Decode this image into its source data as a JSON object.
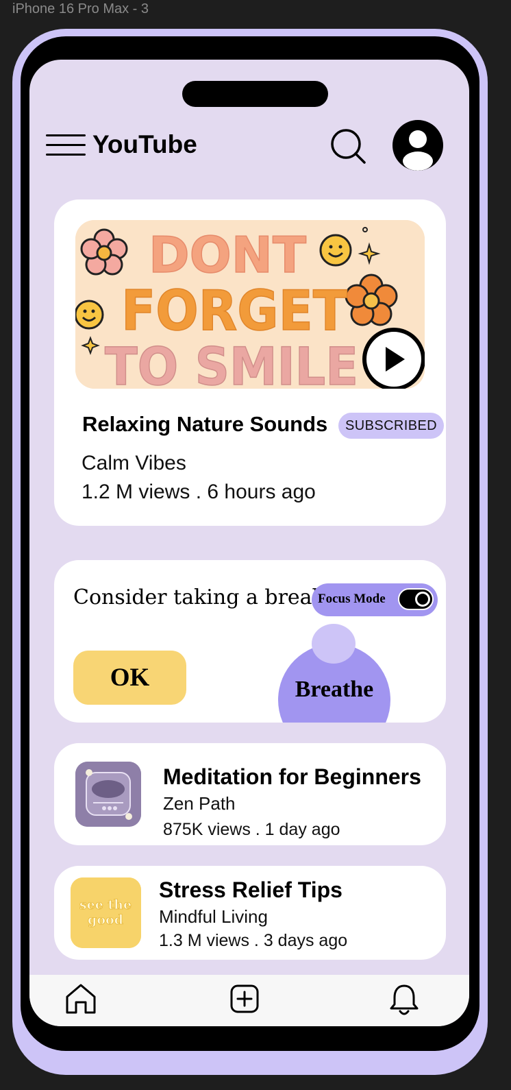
{
  "frame_label": "iPhone 16 Pro Max - 3",
  "header": {
    "title": "YouTube",
    "menu_icon": "menu-icon",
    "search_icon": "search-icon",
    "avatar_icon": "user-avatar-icon"
  },
  "featured_video": {
    "thumbnail_text": [
      "DONT",
      "FORGET",
      "TO SMILE"
    ],
    "title": "Relaxing Nature Sounds",
    "badge": "SUBSCRIBED",
    "channel": "Calm Vibes",
    "meta": "1.2 M views . 6 hours ago"
  },
  "break_card": {
    "text": "Consider taking a break",
    "focus_label": "Focus Mode",
    "focus_on": true,
    "ok_label": "OK",
    "breathe_label": "Breathe"
  },
  "videos": [
    {
      "title": "Meditation for Beginners",
      "channel": "Zen Path",
      "meta": "875K views . 1 day ago"
    },
    {
      "title": "Stress Relief Tips",
      "channel": "Mindful Living",
      "meta": "1.3 M views . 3 days ago",
      "thumbnail_text": [
        "see the",
        "good"
      ]
    }
  ],
  "bottom_nav": {
    "items": [
      "home-icon",
      "add-icon",
      "bell-icon"
    ]
  },
  "colors": {
    "background": "#1e1e1e",
    "phone_frame": "#cdc4f7",
    "screen": "#e3daf0",
    "accent": "#a195f0",
    "ok_button": "#f8d574"
  }
}
